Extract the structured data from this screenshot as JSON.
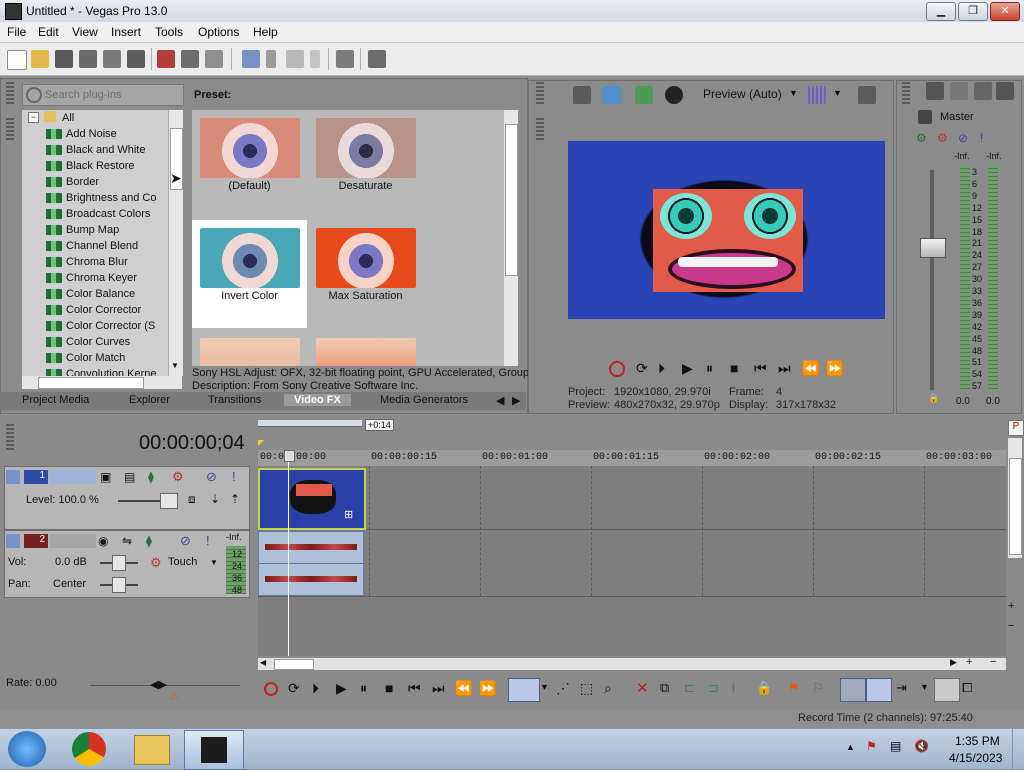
{
  "window": {
    "title": "Untitled * - Vegas Pro 13.0",
    "min_glyph": "▁",
    "max_glyph": "❐",
    "close_glyph": "✕"
  },
  "menu": [
    "File",
    "Edit",
    "View",
    "Insert",
    "Tools",
    "Options",
    "Help"
  ],
  "plugins": {
    "search_placeholder": "Search plug-ins",
    "root": "All",
    "items": [
      "Add Noise",
      "Black and White",
      "Black Restore",
      "Border",
      "Brightness and Co",
      "Broadcast Colors",
      "Bump Map",
      "Channel Blend",
      "Chroma Blur",
      "Chroma Keyer",
      "Color Balance",
      "Color Corrector",
      "Color Corrector (S",
      "Color Curves",
      "Color Match",
      "Convolution Kerne"
    ],
    "preset_header": "Preset:",
    "presets": [
      {
        "label": "(Default)",
        "selected": false
      },
      {
        "label": "Desaturate",
        "selected": false
      },
      {
        "label": "Invert Color",
        "selected": true
      },
      {
        "label": "Max Saturation",
        "selected": false
      }
    ],
    "desc1": "Sony HSL Adjust: OFX, 32-bit floating point, GPU Accelerated, Group",
    "desc2": "Description: From Sony Creative Software Inc."
  },
  "tabs": [
    "Project Media",
    "Explorer",
    "Transitions",
    "Video FX",
    "Media Generators"
  ],
  "active_tab": "Video FX",
  "preview": {
    "mode": "Preview (Auto)",
    "project_label": "Project:",
    "project_value": "1920x1080, 29.970i",
    "preview_label": "Preview:",
    "preview_value": "480x270x32, 29.970p",
    "frame_label": "Frame:",
    "frame_value": "4",
    "display_label": "Display:",
    "display_value": "317x178x32"
  },
  "master": {
    "label": "Master",
    "inf_left": "-Inf.",
    "inf_right": "-Inf.",
    "scale": [
      "3",
      "6",
      "9",
      "12",
      "15",
      "18",
      "21",
      "24",
      "27",
      "30",
      "33",
      "36",
      "39",
      "42",
      "45",
      "48",
      "51",
      "54",
      "57"
    ],
    "zero_left": "0.0",
    "zero_right": "0.0"
  },
  "timeline": {
    "timecode": "00:00:00;04",
    "loop_marker": "+0:14",
    "ruler": [
      "00:00:00:00",
      "00:00:00:15",
      "00:00:01:00",
      "00:00:01:15",
      "00:00:02:00",
      "00:00:02:15",
      "00:00:03:00"
    ],
    "video_track": {
      "number": "1",
      "level_label": "Level: 100.0 %"
    },
    "audio_track": {
      "number": "2",
      "vol_label": "Vol:",
      "vol_value": "0.0 dB",
      "pan_label": "Pan:",
      "pan_value": "Center",
      "touch": "Touch",
      "inf": "-Inf.",
      "meter_scale": [
        "12",
        "24",
        "36",
        "48"
      ]
    },
    "rate": "Rate: 0.00",
    "record_time": "Record Time (2 channels): 97:25:40"
  },
  "taskbar": {
    "time": "1:35 PM",
    "date": "4/15/2023"
  },
  "colors": {
    "accent": "#2a44b5",
    "selection": "#ffffff",
    "video_clip_border": "#c8d14a"
  }
}
